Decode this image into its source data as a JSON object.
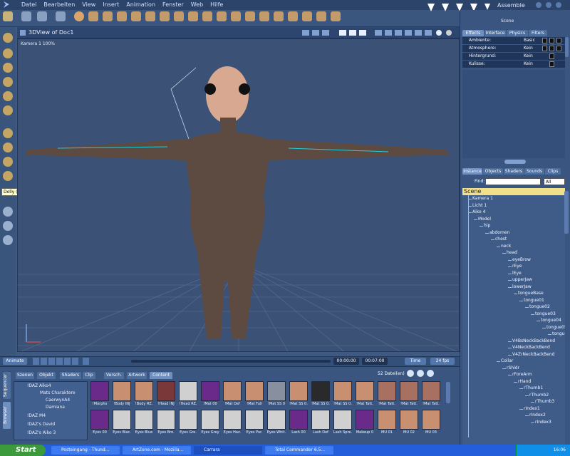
{
  "menu": {
    "items": [
      "Datei",
      "Bearbeiten",
      "View",
      "Insert",
      "Animation",
      "Fenster",
      "Web",
      "Hilfe"
    ]
  },
  "header": {
    "room": "Assemble"
  },
  "viewport": {
    "title": "3DView of Doc1",
    "camera": "Kamera 1 100%"
  },
  "tooltip": {
    "text": "Dolly (D)"
  },
  "animation": {
    "animate_label": "Animate",
    "time_start": "00:00:00",
    "time_end": "00:07:00",
    "time_label": "Time",
    "fps": "24 fps"
  },
  "browser": {
    "tabs": [
      "Szenen",
      "Objekt",
      "Shaders",
      "Clip",
      "Versch.",
      "Artwork",
      "Content"
    ],
    "file_count": "52 Datei(en)",
    "side_tabs": [
      "Sequencer",
      "Browser"
    ],
    "tree": [
      "!DAZ Aiko4",
      "Mats Charaktere",
      "CaerwynA4",
      "Damiana",
      "!DAZ M4",
      "!DAZ's David",
      "!DAZ's Aiko 3"
    ],
    "row1": [
      "!Morphs",
      "!Body INJ",
      "!Body RE.",
      "!Head INJ",
      "!Head RE.",
      "!Mat 00",
      "!Mat Def",
      "!Mat Full",
      "!Mat SS 0",
      "!Mat SS 0.",
      "!Mat SS 0.",
      "!Mat SS 0.",
      "!Mat Tatt.",
      "!Mat Tatt.",
      "!Mat Tatt.",
      "!Mat Tatt."
    ],
    "row2": [
      "Eyes 00",
      "Eyes Blac.",
      "Eyes Blue",
      "Eyes Bro.",
      "Eyes Gre.",
      "Eyes Grey",
      "Eyes Haz.",
      "Eyes Pur.",
      "Eyes Whit.",
      "Lash 00",
      "Lash Def",
      "Lash Spre.",
      "Makeup 0",
      "MU 01",
      "MU 02",
      "MU 03"
    ]
  },
  "right_panel": {
    "title": "Scene",
    "effects_tabs": [
      "Effects",
      "Interface",
      "Physics",
      "Filters"
    ],
    "effects": [
      {
        "name": "Ambiente:",
        "value": "Basic"
      },
      {
        "name": "Atmosphere:",
        "value": "Kein"
      },
      {
        "name": "Hintergrund:",
        "value": "Kein"
      },
      {
        "name": "Kulisse:",
        "value": "Kein"
      }
    ],
    "instance_tabs": [
      "Instance",
      "Objects",
      "Shaders",
      "Sounds",
      "Clips"
    ],
    "find_label": "Find:",
    "find_select": "All",
    "scene_label": "Scene",
    "nodes": [
      "Kamera 1",
      "Licht 1",
      "Aiko 4",
      "Model",
      "hip",
      "abdomen",
      "chest",
      "neck",
      "head",
      "eyeBrow",
      "rEye",
      "lEye",
      "upperJaw",
      "lowerJaw",
      "tongueBase",
      "tongue01",
      "tongue02",
      "tongue03",
      "tongue04",
      "tongue05",
      "tongue",
      "V4BsNeckBackBend",
      "V4NeckBackBend",
      "V4ZrNeckBackBend",
      "Collar",
      "rShldr",
      "rForeArm",
      "rHand",
      "rThumb1",
      "rThumb2",
      "rThumb3",
      "rIndex1",
      "rIndex2",
      "rIndex3"
    ]
  },
  "taskbar": {
    "start": "Start",
    "tasks": [
      "Posteingang - Thund...",
      "ArtZone.com - Mozilla...",
      "Carrara",
      "Total Commander 6.5..."
    ],
    "clock": "16:06"
  }
}
